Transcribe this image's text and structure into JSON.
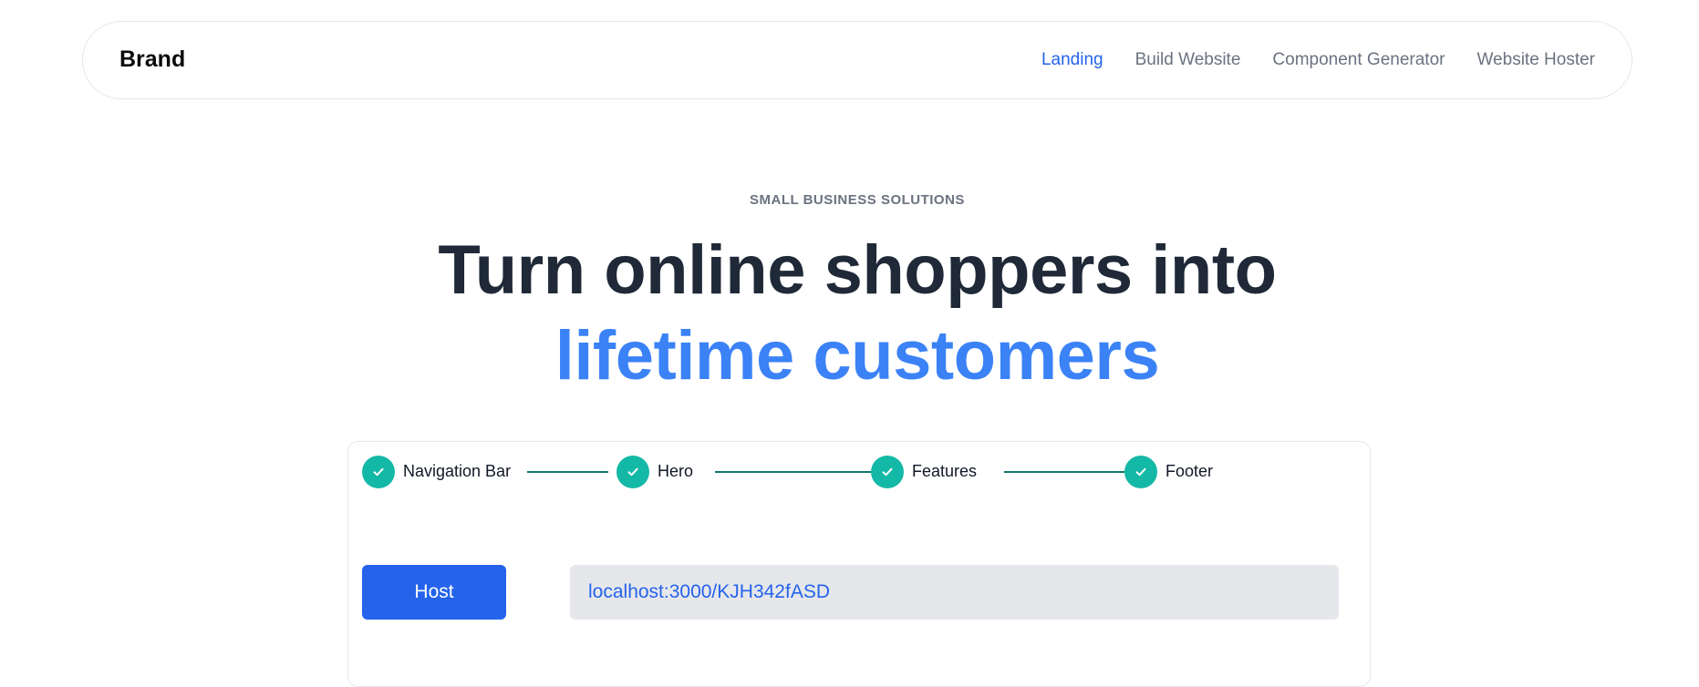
{
  "nav": {
    "brand": "Brand",
    "links": [
      {
        "label": "Landing",
        "active": true
      },
      {
        "label": "Build Website",
        "active": false
      },
      {
        "label": "Component Generator",
        "active": false
      },
      {
        "label": "Website Hoster",
        "active": false
      }
    ]
  },
  "hero": {
    "eyebrow": "SMALL BUSINESS SOLUTIONS",
    "headline_line1": "Turn online shoppers into",
    "headline_line2": "lifetime customers"
  },
  "steps": [
    {
      "label": "Navigation Bar",
      "icon": "check-icon",
      "completed": true
    },
    {
      "label": "Hero",
      "icon": "check-icon",
      "completed": true
    },
    {
      "label": "Features",
      "icon": "check-icon",
      "completed": true
    },
    {
      "label": "Footer",
      "icon": "check-icon",
      "completed": true
    }
  ],
  "hosting": {
    "button_label": "Host",
    "url": "localhost:3000/KJH342fASD"
  },
  "colors": {
    "accent": "#3b82f6",
    "primary_button": "#2563eb",
    "step_complete": "#14b8a6",
    "connector": "#0f766e",
    "heading": "#1f2937",
    "muted": "#6b7280"
  }
}
